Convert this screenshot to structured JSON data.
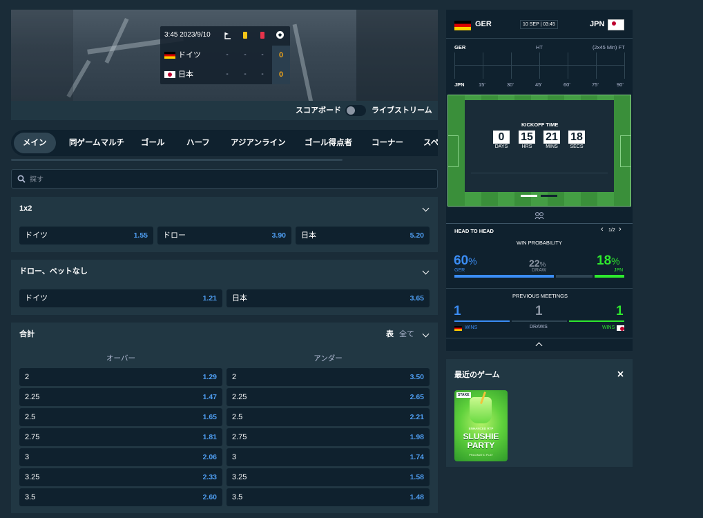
{
  "scoreboard": {
    "time": "3:45 2023/9/10",
    "teams": [
      {
        "name": "ドイツ",
        "corners": "-",
        "yellow": "-",
        "red": "-",
        "goals": "0"
      },
      {
        "name": "日本",
        "corners": "-",
        "yellow": "-",
        "red": "-",
        "goals": "0"
      }
    ]
  },
  "toggle": {
    "scoreboard_label": "スコアボード",
    "stream_label": "ライブストリーム"
  },
  "tabs": [
    "メイン",
    "同ゲームマルチ",
    "ゴール",
    "ハーフ",
    "アジアンライン",
    "ゴール得点者",
    "コーナー",
    "スペ"
  ],
  "search": {
    "placeholder": "探す"
  },
  "markets": {
    "m1x2": {
      "title": "1x2",
      "options": [
        {
          "label": "ドイツ",
          "odds": "1.55"
        },
        {
          "label": "ドロー",
          "odds": "3.90"
        },
        {
          "label": "日本",
          "odds": "5.20"
        }
      ]
    },
    "dnb": {
      "title": "ドロー、ベットなし",
      "options": [
        {
          "label": "ドイツ",
          "odds": "1.21"
        },
        {
          "label": "日本",
          "odds": "3.65"
        }
      ]
    },
    "total": {
      "title": "合計",
      "table_label": "表",
      "filter_label": "全て",
      "over_label": "オーバー",
      "under_label": "アンダー",
      "rows": [
        {
          "line": "2",
          "over": "1.29",
          "under": "3.50"
        },
        {
          "line": "2.25",
          "over": "1.47",
          "under": "2.65"
        },
        {
          "line": "2.5",
          "over": "1.65",
          "under": "2.21"
        },
        {
          "line": "2.75",
          "over": "1.81",
          "under": "1.98"
        },
        {
          "line": "3",
          "over": "2.06",
          "under": "1.74"
        },
        {
          "line": "3.25",
          "over": "2.33",
          "under": "1.58"
        },
        {
          "line": "3.5",
          "over": "2.60",
          "under": "1.48"
        }
      ]
    }
  },
  "widget": {
    "home": "GER",
    "away": "JPN",
    "date": "10 SEP | 03:45",
    "timeline": {
      "home": "GER",
      "away": "JPN",
      "ht": "HT",
      "ft": "(2x45 Min) FT",
      "ticks": [
        "15'",
        "30'",
        "45'",
        "60'",
        "75'",
        "90'"
      ]
    },
    "kickoff": {
      "title": "KICKOFF TIME",
      "values": [
        "0",
        "15",
        "21",
        "18"
      ],
      "labels": [
        "DAYS",
        "HRS",
        "MINS",
        "SECS"
      ]
    },
    "h2h": {
      "title": "HEAD TO HEAD",
      "page": "1/2",
      "win_prob_title": "WIN PROBABILITY",
      "home_pct": "60",
      "draw_pct": "22",
      "away_pct": "18",
      "pct_sign": "%",
      "home": "GER",
      "draw": "DRAW",
      "away": "JPN",
      "meetings_title": "PREVIOUS MEETINGS",
      "home_wins": "1",
      "draws": "1",
      "away_wins": "1",
      "wins_label": "WINS",
      "draws_label": "DRAWS"
    },
    "colors": {
      "home": "#3b8df5",
      "away": "#2ee82e",
      "draw": "#8b95a3"
    }
  },
  "recent": {
    "title": "最近のゲーム",
    "game": {
      "badge": "STAKE",
      "tagline": "ENHANCED RTP",
      "name_line1": "SLUSHIE",
      "name_line2": "PARTY",
      "provider": "PRAGMATIC PLAY"
    }
  }
}
